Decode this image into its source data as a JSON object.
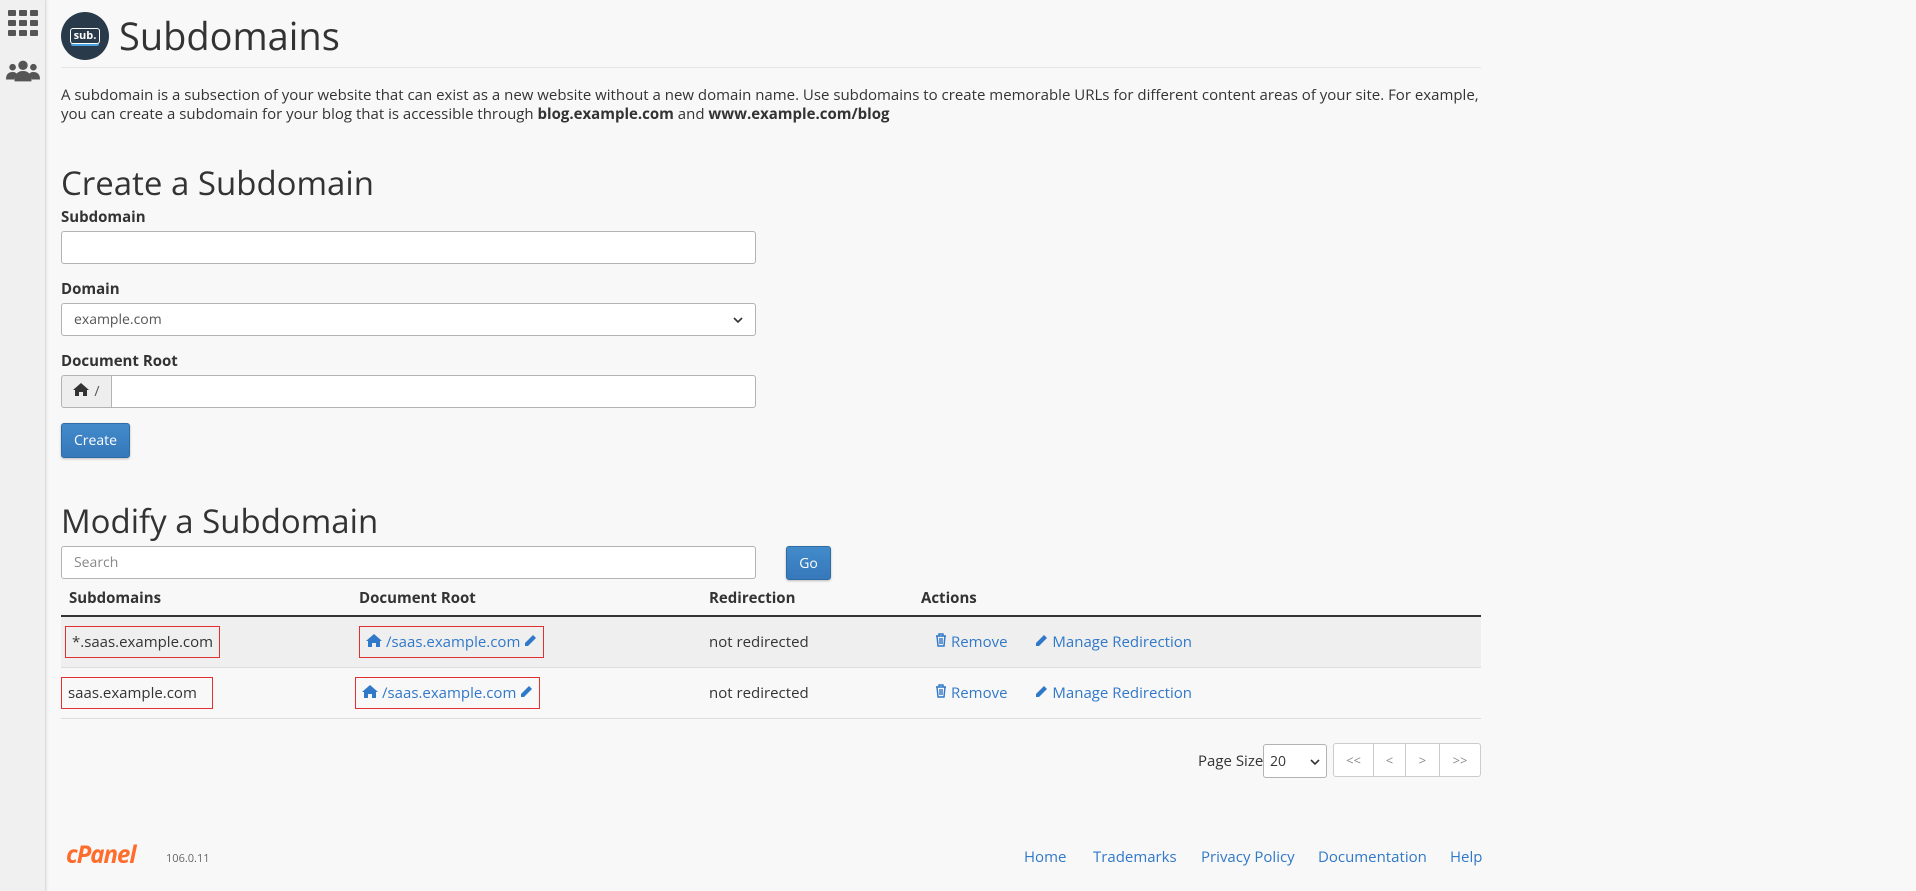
{
  "page": {
    "title": "Subdomains",
    "logo_text": "sub.",
    "description_prefix": "A subdomain is a subsection of your website that can exist as a new website without a new domain name. Use subdomains to create memorable URLs for different content areas of your site. For example, you can create a subdomain for your blog that is accessible through ",
    "description_ex1": "blog.example.com",
    "description_and": " and ",
    "description_ex2": "www.example.com/blog"
  },
  "create": {
    "heading": "Create a Subdomain",
    "subdomain_label": "Subdomain",
    "subdomain_value": "",
    "domain_label": "Domain",
    "domain_selected": "example.com",
    "docroot_label": "Document Root",
    "docroot_prefix": "/",
    "docroot_value": "",
    "create_button": "Create"
  },
  "modify": {
    "heading": "Modify a Subdomain",
    "search_placeholder": "Search",
    "go_button": "Go",
    "columns": [
      "Subdomains",
      "Document Root",
      "Redirection",
      "Actions"
    ],
    "rows": [
      {
        "subdomain": "*.saas.example.com",
        "docroot": "/saas.example.com",
        "redirection": "not redirected",
        "remove": "Remove",
        "manage": "Manage Redirection"
      },
      {
        "subdomain": "saas.example.com",
        "docroot": "/saas.example.com",
        "redirection": "not redirected",
        "remove": "Remove",
        "manage": "Manage Redirection"
      }
    ],
    "page_size_label": "Page Size",
    "page_size_value": "20",
    "pager": [
      "<<",
      "<",
      ">",
      ">>"
    ]
  },
  "footer": {
    "brand": "cPanel",
    "version": "106.0.11",
    "links": [
      "Home",
      "Trademarks",
      "Privacy Policy",
      "Documentation",
      "Help"
    ]
  },
  "colors": {
    "accent": "#3078c8",
    "brand_orange": "#ff6c2c",
    "highlight_red": "#e03030"
  }
}
